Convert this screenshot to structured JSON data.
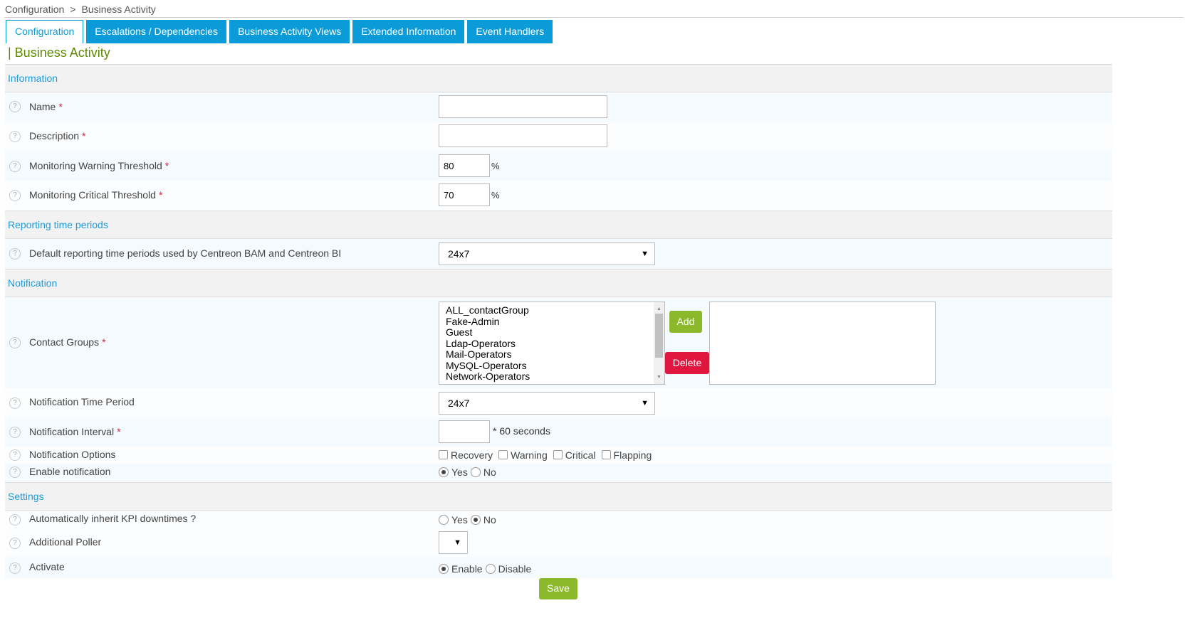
{
  "breadcrumb": {
    "root": "Configuration",
    "separator": ">",
    "current": "Business Activity"
  },
  "tabs": [
    {
      "label": "Configuration",
      "active": true
    },
    {
      "label": "Escalations / Dependencies"
    },
    {
      "label": "Business Activity Views"
    },
    {
      "label": "Extended Information"
    },
    {
      "label": "Event Handlers"
    }
  ],
  "page_title": "| Business Activity",
  "sections": {
    "information": "Information",
    "reporting": "Reporting time periods",
    "notification": "Notification",
    "settings": "Settings"
  },
  "fields": {
    "name": {
      "label": "Name",
      "value": ""
    },
    "description": {
      "label": "Description",
      "value": ""
    },
    "warning_threshold": {
      "label": "Monitoring Warning Threshold",
      "value": "80",
      "unit": "%"
    },
    "critical_threshold": {
      "label": "Monitoring Critical Threshold",
      "value": "70",
      "unit": "%"
    },
    "reporting_period": {
      "label": "Default reporting time periods used by Centreon BAM and Centreon BI",
      "value": "24x7"
    },
    "contact_groups": {
      "label": "Contact Groups",
      "options": [
        "ALL_contactGroup",
        "Fake-Admin",
        "Guest",
        "Ldap-Operators",
        "Mail-Operators",
        "MySQL-Operators",
        "Network-Operators"
      ],
      "add_label": "Add",
      "delete_label": "Delete"
    },
    "notification_period": {
      "label": "Notification Time Period",
      "value": "24x7"
    },
    "notification_interval": {
      "label": "Notification Interval",
      "value": "",
      "suffix": "* 60 seconds"
    },
    "notification_options": {
      "label": "Notification Options",
      "options": [
        "Recovery",
        "Warning",
        "Critical",
        "Flapping"
      ]
    },
    "enable_notification": {
      "label": "Enable notification",
      "yes": "Yes",
      "no": "No",
      "selected": "Yes"
    },
    "inherit_downtimes": {
      "label": "Automatically inherit KPI downtimes ?",
      "yes": "Yes",
      "no": "No",
      "selected": "No"
    },
    "additional_poller": {
      "label": "Additional Poller",
      "value": ""
    },
    "activate": {
      "label": "Activate",
      "enable": "Enable",
      "disable": "Disable",
      "selected": "Enable"
    }
  },
  "required_mark": "*",
  "help_glyph": "?",
  "caret_glyph": "▼",
  "save_label": "Save",
  "colors": {
    "accent": "#0a9bd8",
    "title": "#5e8a00",
    "add": "#8cb82c",
    "delete": "#e0163f",
    "required": "#d81f3c"
  }
}
